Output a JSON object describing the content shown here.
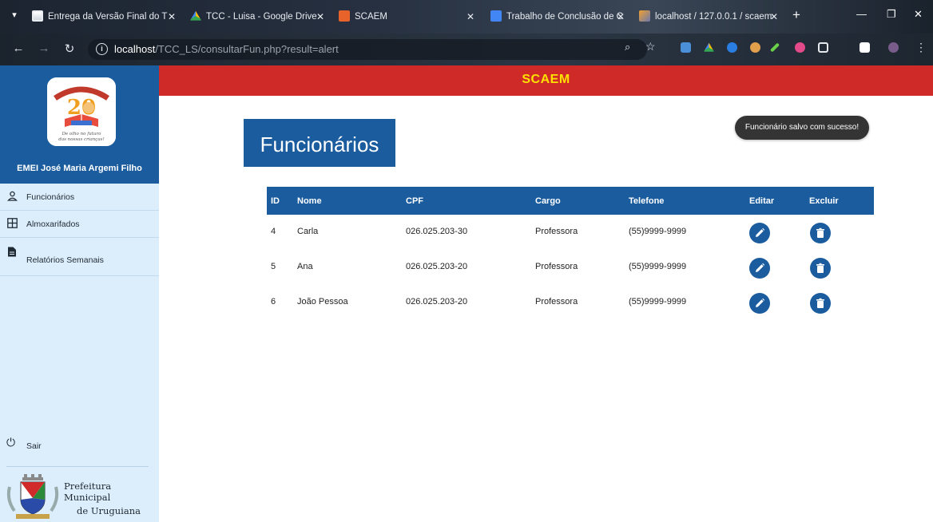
{
  "browser": {
    "tabs": [
      {
        "label": "Entrega da Versão Final do T",
        "icon": "classroom-icon",
        "color": "#ffffff"
      },
      {
        "label": "TCC - Luisa - Google Drive",
        "icon": "google-drive-icon",
        "color": "#fbbc04"
      },
      {
        "label": "SCAEM",
        "icon": "scaem-favicon",
        "color": "#e8622c"
      },
      {
        "label": "Trabalho de Conclusão de C",
        "icon": "google-docs-icon",
        "color": "#4285f4"
      },
      {
        "label": "localhost / 127.0.0.1 / scaem",
        "icon": "phpmyadmin-icon",
        "color": "#f0a030"
      }
    ],
    "url_host": "localhost",
    "url_path": "/TCC_LS/consultarFun.php?result=alert"
  },
  "sidebar": {
    "school_name": "EMEI José Maria Argemi Filho",
    "items": [
      {
        "label": "Funcionários",
        "icon": "user-icon"
      },
      {
        "label": "Almoxarifados",
        "icon": "grid-icon"
      },
      {
        "label": "Relatórios Semanais",
        "icon": "document-icon"
      }
    ],
    "logout_label": "Sair",
    "prefeitura_line1": "Prefeitura Municipal",
    "prefeitura_line2": "de Uruguiana"
  },
  "header": {
    "brand": "SCAEM",
    "bar_color": "#d02a28",
    "brand_color": "#ffe100"
  },
  "main": {
    "page_title": "Funcionários",
    "toast_message": "Funcionário salvo com sucesso!",
    "accent_color": "#1a5c9e",
    "table": {
      "columns": [
        "ID",
        "Nome",
        "CPF",
        "Cargo",
        "Telefone",
        "Editar",
        "Excluir"
      ],
      "rows": [
        {
          "id": "4",
          "nome": "Carla",
          "cpf": "026.025.203-30",
          "cargo": "Professora",
          "telefone": "(55)9999-9999"
        },
        {
          "id": "5",
          "nome": "Ana",
          "cpf": "026.025.203-20",
          "cargo": "Professora",
          "telefone": "(55)9999-9999"
        },
        {
          "id": "6",
          "nome": "João Pessoa",
          "cpf": "026.025.203-20",
          "cargo": "Professora",
          "telefone": "(55)9999-9999"
        }
      ]
    }
  }
}
